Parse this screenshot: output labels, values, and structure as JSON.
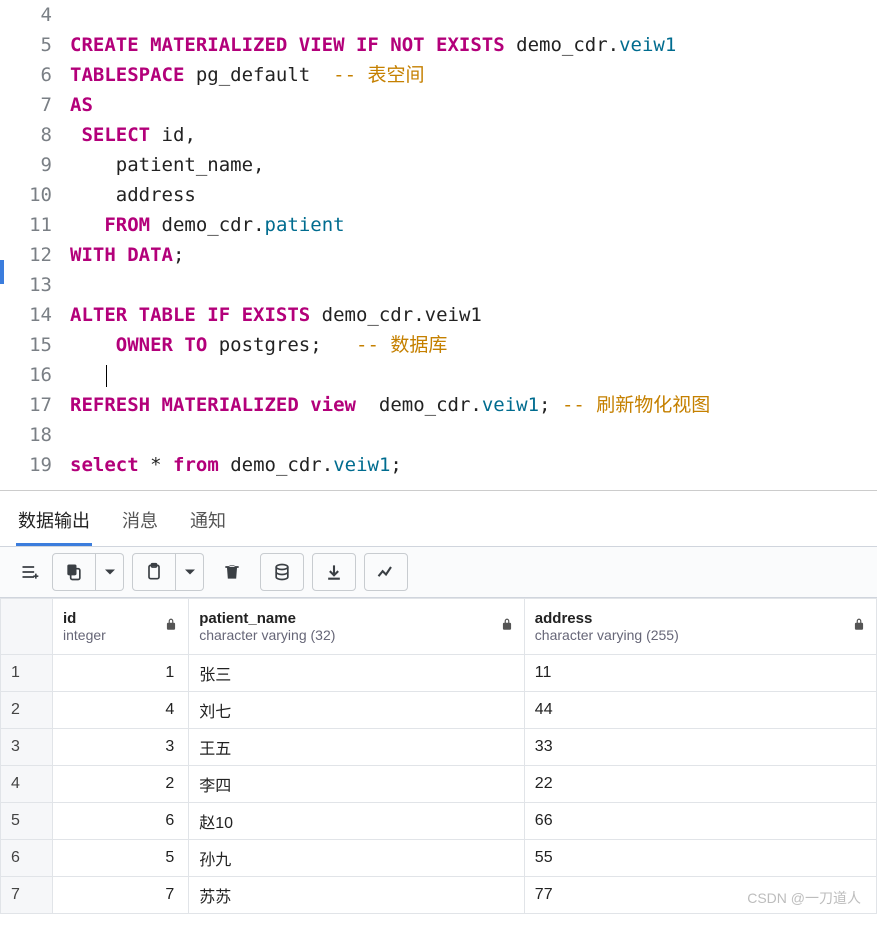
{
  "editor": {
    "lines": [
      {
        "num": 4,
        "html": ""
      },
      {
        "num": 5,
        "html": "<span class='kw'>CREATE MATERIALIZED VIEW IF NOT EXISTS</span> <span class='ident'>demo_cdr</span><span class='dot'>.</span><span class='sch'>veiw1</span>"
      },
      {
        "num": 6,
        "html": "<span class='kw'>TABLESPACE</span> <span class='ident'>pg_default</span>  <span class='cmt'>-- 表空间</span>"
      },
      {
        "num": 7,
        "html": "<span class='kw'>AS</span>"
      },
      {
        "num": 8,
        "html": " <span class='kw'>SELECT</span> <span class='ident'>id</span><span class='punc'>,</span>"
      },
      {
        "num": 9,
        "html": "    <span class='ident'>patient_name</span><span class='punc'>,</span>"
      },
      {
        "num": 10,
        "html": "    <span class='ident'>address</span>"
      },
      {
        "num": 11,
        "html": "   <span class='kw'>FROM</span> <span class='ident'>demo_cdr</span><span class='dot'>.</span><span class='sch'>patient</span>"
      },
      {
        "num": 12,
        "html": "<span class='kw'>WITH DATA</span><span class='punc'>;</span>"
      },
      {
        "num": 13,
        "html": ""
      },
      {
        "num": 14,
        "html": "<span class='kw'>ALTER TABLE IF EXISTS</span> <span class='ident'>demo_cdr</span><span class='dot'>.</span><span class='ident'>veiw1</span>"
      },
      {
        "num": 15,
        "html": "    <span class='kw'>OWNER TO</span> <span class='ident'>postgres</span><span class='punc'>;</span>   <span class='cmt'>-- 数据库</span>"
      },
      {
        "num": 16,
        "html": "",
        "caret": true
      },
      {
        "num": 17,
        "html": "<span class='kw'>REFRESH MATERIALIZED view</span>  <span class='ident'>demo_cdr</span><span class='dot'>.</span><span class='sch'>veiw1</span><span class='punc'>;</span> <span class='cmt'>-- 刷新物化视图</span>"
      },
      {
        "num": 18,
        "html": ""
      },
      {
        "num": 19,
        "html": "<span class='kw'>select</span> <span class='punc'>*</span> <span class='kw'>from</span> <span class='ident'>demo_cdr</span><span class='dot'>.</span><span class='sch'>veiw1</span><span class='punc'>;</span>"
      }
    ]
  },
  "tabs": {
    "data_output": "数据输出",
    "messages": "消息",
    "notifications": "通知"
  },
  "columns": [
    {
      "name": "id",
      "type": "integer",
      "align": "num"
    },
    {
      "name": "patient_name",
      "type": "character varying (32)",
      "align": "text"
    },
    {
      "name": "address",
      "type": "character varying (255)",
      "align": "text"
    }
  ],
  "rows": [
    {
      "n": "1",
      "id": "1",
      "patient_name": "张三",
      "address": "11"
    },
    {
      "n": "2",
      "id": "4",
      "patient_name": "刘七",
      "address": "44"
    },
    {
      "n": "3",
      "id": "3",
      "patient_name": "王五",
      "address": "33"
    },
    {
      "n": "4",
      "id": "2",
      "patient_name": "李四",
      "address": "22"
    },
    {
      "n": "5",
      "id": "6",
      "patient_name": "赵10",
      "address": "66"
    },
    {
      "n": "6",
      "id": "5",
      "patient_name": "孙九",
      "address": "55"
    },
    {
      "n": "7",
      "id": "7",
      "patient_name": "苏苏",
      "address": "77"
    }
  ],
  "watermark": "CSDN @一刀道人"
}
